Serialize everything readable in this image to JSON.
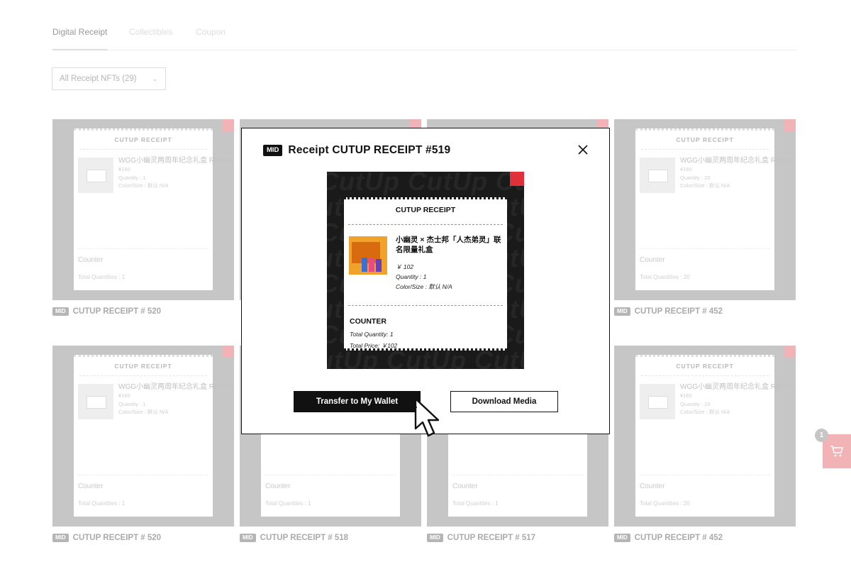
{
  "tabs": [
    {
      "label": "Digital Receipt",
      "active": true
    },
    {
      "label": "Collectibles",
      "active": false
    },
    {
      "label": "Coupon",
      "active": false
    }
  ],
  "filter": {
    "label": "All Receipt NFTs (29)"
  },
  "receipt_card_template": {
    "header": "CUTUP RECEIPT",
    "counter": "Counter"
  },
  "cards": [
    {
      "title": "WGG小幽灵两周年纪念礼盒 REMOVE...",
      "price": "¥160",
      "quantity": "Quantity : 1",
      "color_size": "Color/Size : 默认 N/A",
      "total_quantity": "Total Quantities : 1",
      "label": "CUTUP RECEIPT # 520"
    },
    {
      "title": "",
      "price": "",
      "quantity": "",
      "color_size": "",
      "total_quantity": "",
      "label": ""
    },
    {
      "title": "",
      "price": "",
      "quantity": "",
      "color_size": "",
      "total_quantity": "",
      "label": ""
    },
    {
      "title": "WGG小幽灵两周年纪念礼盒 REMOVE...",
      "price": "¥160",
      "quantity": "Quantity : 20",
      "color_size": "Color/Size : 默认 N/A",
      "total_quantity": "Total Quantities : 20",
      "label": "CUTUP RECEIPT # 452"
    },
    {
      "title": "WGG小幽灵两周年纪念礼盒 REMOVE...",
      "price": "¥160",
      "quantity": "Quantity : 1",
      "color_size": "Color/Size : 默认 N/A",
      "total_quantity": "Total Quantities : 1",
      "label": "CUTUP RECEIPT # 520"
    },
    {
      "title": "",
      "price": "",
      "quantity": "",
      "color_size": "",
      "total_quantity": "Total Quantites : 1",
      "label": "CUTUP RECEIPT # 518"
    },
    {
      "title": "",
      "price": "",
      "quantity": "",
      "color_size": "",
      "total_quantity": "Total Quantites : 1",
      "label": "CUTUP RECEIPT # 517"
    },
    {
      "title": "WGG小幽灵两周年纪念礼盒 REMOVE...",
      "price": "¥160",
      "quantity": "Quantity : 20",
      "color_size": "Color/Size : 默认 N/A",
      "total_quantity": "Total Quantities : 20",
      "label": "CUTUP RECEIPT # 452"
    }
  ],
  "badge": "MID",
  "cart": {
    "count": "1",
    "icon": "cart-icon"
  },
  "modal": {
    "badge": "MID",
    "title": "Receipt CUTUP RECEIPT #519",
    "receipt": {
      "header": "CUTUP RECEIPT",
      "item_title": "小幽灵 × 杰士邦「人杰弟灵」联名限量礼盒",
      "price": "￥ 102",
      "quantity": "Quantity : 1",
      "color_size": "Color/Size : 默认 N/A",
      "counter_label": "COUNTER",
      "total_quantity": "Total Quantity: 1",
      "total_price": "Total Price: ￥102"
    },
    "bg_pattern_text": "CutUp",
    "transfer_button": "Transfer to My Wallet",
    "download_button": "Download Media"
  },
  "colors": {
    "accent_red": "#e0303a",
    "pink": "#f2b3b6",
    "dark": "#111111"
  }
}
